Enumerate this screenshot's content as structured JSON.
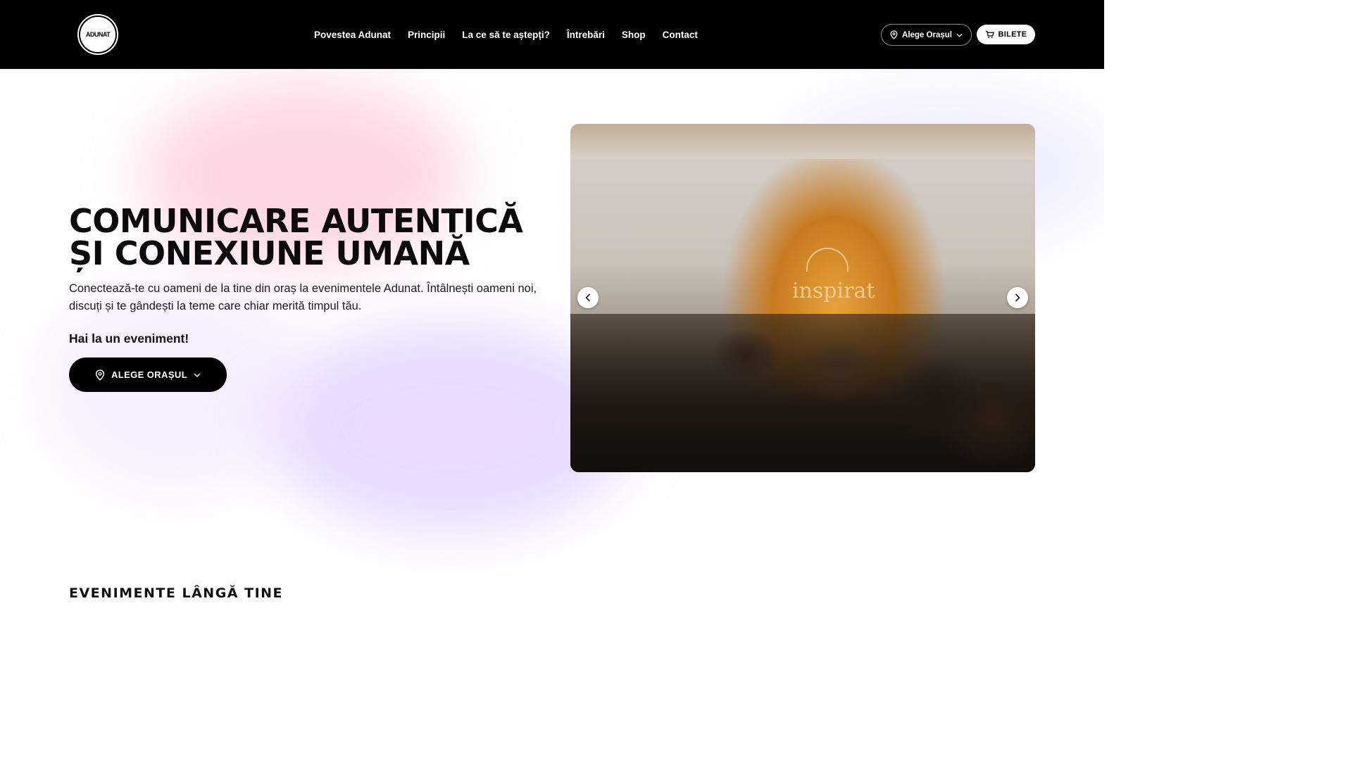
{
  "header": {
    "logo_text": "ADUNAT",
    "nav": [
      "Povestea Adunat",
      "Principii",
      "La ce să te aștepți?",
      "Întrebări",
      "Shop",
      "Contact"
    ],
    "city_selector": "Alege Orașul",
    "tickets": "BILETE"
  },
  "hero": {
    "headline_line1": "COMUNICARE AUTENTICĂ",
    "headline_line2": "ȘI CONEXIUNE UMANĂ",
    "subtext": "Conectează-te cu oameni de la tine din oraș la evenimentele Adunat. Întâlnești oameni noi, discuți și te gândești la teme care chiar merită timpul tău.",
    "cta_label": "Hai la un eveniment!",
    "cta_button": "ALEGE ORAȘUL",
    "carousel": {
      "photo_sign_text": "inspirat",
      "prev_icon": "chevron-left-icon",
      "next_icon": "chevron-right-icon"
    }
  },
  "events": {
    "section_label": "EVENIMENTE LÂNGĂ TINE"
  },
  "icons": {
    "location": "location-pin-icon",
    "chevron_down": "chevron-down-icon",
    "cart": "cart-icon"
  },
  "colors": {
    "header_bg": "#000000",
    "accent_pink": "#ffb6ce",
    "accent_violet": "#d6beff"
  }
}
